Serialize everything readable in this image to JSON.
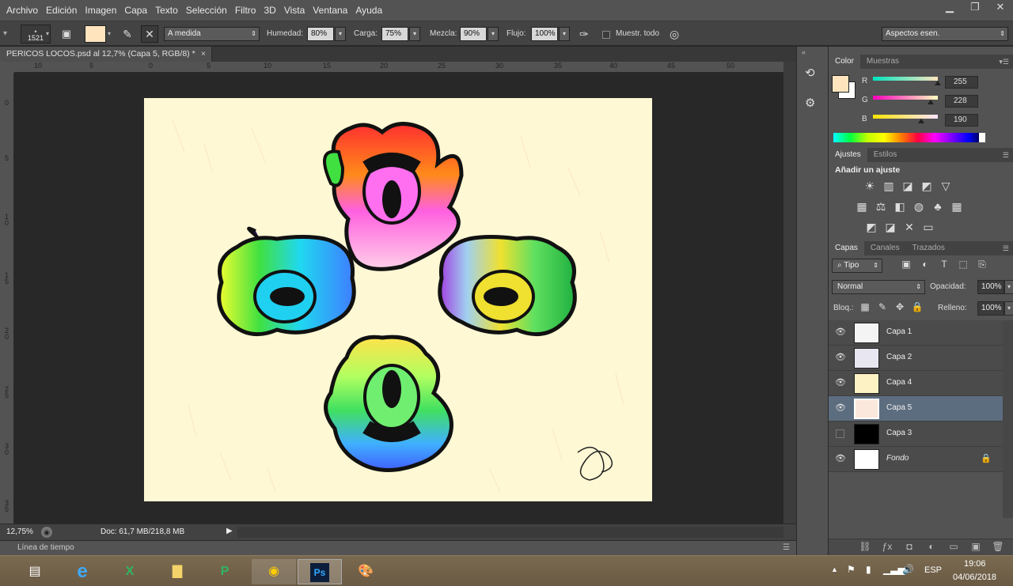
{
  "menu": [
    "Archivo",
    "Edición",
    "Imagen",
    "Capa",
    "Texto",
    "Selección",
    "Filtro",
    "3D",
    "Vista",
    "Ventana",
    "Ayuda"
  ],
  "window_controls": [
    "▁",
    "❐",
    "✕"
  ],
  "options": {
    "brush_size": "1521",
    "mode": "A medida",
    "humedad_label": "Humedad:",
    "humedad_value": "80%",
    "carga_label": "Carga:",
    "carga_value": "75%",
    "mezcla_label": "Mezcla:",
    "mezcla_value": "90%",
    "flujo_label": "Flujo:",
    "flujo_value": "100%",
    "muestrear_label": "Muestr. todo",
    "workspace": "Aspectos esen."
  },
  "document": {
    "tab_title": "PERICOS LOCOS.psd al 12,7% (Capa 5, RGB/8) *",
    "tab_close": "×",
    "zoom": "12,75%",
    "doc_info": "Doc: 61,7 MB/218,8 MB"
  },
  "ruler": {
    "h_ticks": [
      "10",
      "5",
      "0",
      "5",
      "10",
      "15",
      "20",
      "25",
      "30",
      "35",
      "40",
      "45",
      "50"
    ],
    "v_ticks": [
      "0",
      "5",
      "1\n0",
      "1\n5",
      "2\n0",
      "2\n5",
      "3\n0",
      "3\n5"
    ]
  },
  "timeline_label": "Línea de tiempo",
  "color_panel": {
    "tabs": [
      "Color",
      "Muestras"
    ],
    "foreground": "#ffe4be",
    "r_label": "R",
    "r_value": "255",
    "g_label": "G",
    "g_value": "228",
    "b_label": "B",
    "b_value": "190"
  },
  "adjust_panel": {
    "tabs": [
      "Ajustes",
      "Estilos"
    ],
    "heading": "Añadir un ajuste",
    "row1": [
      "☀",
      "▥",
      "◪",
      "◩",
      "▽"
    ],
    "row2": [
      "▦",
      "⚖",
      "◧",
      "◍",
      "♣",
      "▦"
    ],
    "row3": [
      "◩",
      "◪",
      "✕",
      "▭"
    ]
  },
  "layers_panel": {
    "tabs": [
      "Capas",
      "Canales",
      "Trazados"
    ],
    "filter": "Tipo",
    "blend_mode": "Normal",
    "opacity_label": "Opacidad:",
    "opacity_value": "100%",
    "lock_label": "Bloq.:",
    "fill_label": "Relleno:",
    "fill_value": "100%",
    "layers": [
      {
        "name": "Capa 1",
        "visible": true,
        "selected": false,
        "thumb": "#f4f4f4"
      },
      {
        "name": "Capa 2",
        "visible": true,
        "selected": false,
        "thumb": "#e8e6f0"
      },
      {
        "name": "Capa 4",
        "visible": true,
        "selected": false,
        "thumb": "#fdf2c4"
      },
      {
        "name": "Capa 5",
        "visible": true,
        "selected": true,
        "thumb": "#fbe8dc"
      },
      {
        "name": "Capa 3",
        "visible": false,
        "selected": false,
        "thumb": "#000000"
      },
      {
        "name": "Fondo",
        "visible": true,
        "selected": false,
        "thumb": "#ffffff",
        "locked": true
      }
    ]
  },
  "taskbar": {
    "lang": "ESP",
    "time": "19:06",
    "date": "04/06/2018"
  }
}
